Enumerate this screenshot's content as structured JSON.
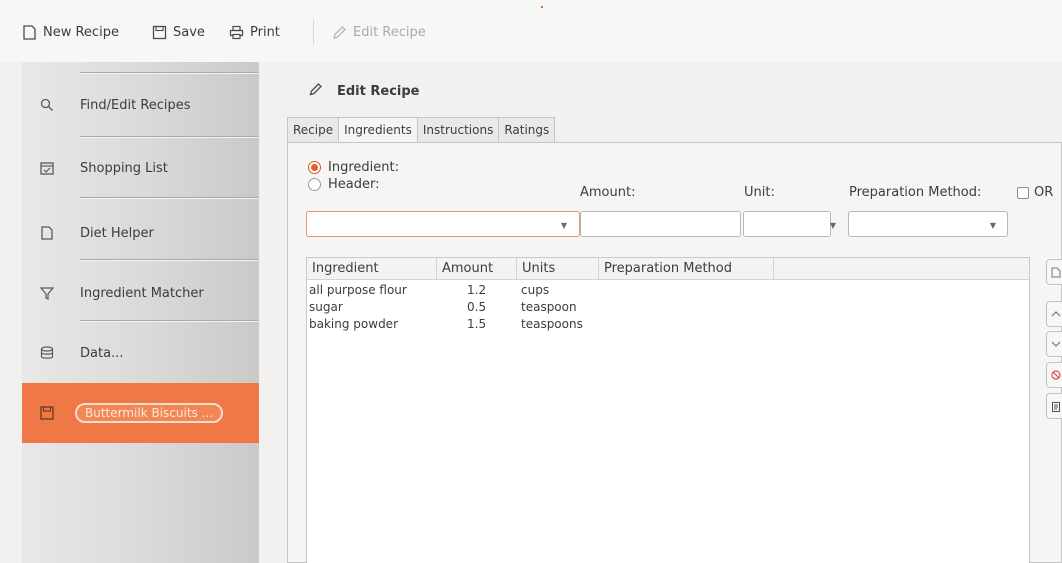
{
  "toolbar": {
    "new_recipe": "New Recipe",
    "save": "Save",
    "print": "Print",
    "edit_recipe": "Edit Recipe"
  },
  "sidebar": {
    "items": [
      {
        "label": "Find/Edit Recipes",
        "icon": "search-icon"
      },
      {
        "label": "Shopping List",
        "icon": "calendar-check-icon"
      },
      {
        "label": "Diet Helper",
        "icon": "document-icon"
      },
      {
        "label": "Ingredient Matcher",
        "icon": "funnel-icon"
      },
      {
        "label": "Data...",
        "icon": "database-icon"
      },
      {
        "label": "Buttermilk Biscuits ...",
        "icon": "floppy-icon"
      }
    ]
  },
  "editor": {
    "title": "Edit Recipe",
    "tabs": [
      "Recipe",
      "Ingredients",
      "Instructions",
      "Ratings"
    ],
    "active_tab": "Ingredients",
    "radio_ingredient": "Ingredient:",
    "radio_header": "Header:",
    "amount_label": "Amount:",
    "unit_label": "Unit:",
    "prep_label": "Preparation Method:",
    "or_label": "OR",
    "ingredient_value": "",
    "amount_value": "",
    "unit_value": "",
    "prep_value": ""
  },
  "table": {
    "columns": [
      "Ingredient",
      "Amount",
      "Units",
      "Preparation Method"
    ],
    "rows": [
      {
        "ingredient": "all purpose flour",
        "amount": "1.2",
        "units": "cups",
        "prep": ""
      },
      {
        "ingredient": "sugar",
        "amount": "0.5",
        "units": "teaspoon",
        "prep": ""
      },
      {
        "ingredient": "baking powder",
        "amount": "1.5",
        "units": "teaspoons",
        "prep": ""
      }
    ]
  },
  "colors": {
    "accent": "#f07746",
    "radio": "#e35f2e",
    "text": "#3c3c3c"
  }
}
